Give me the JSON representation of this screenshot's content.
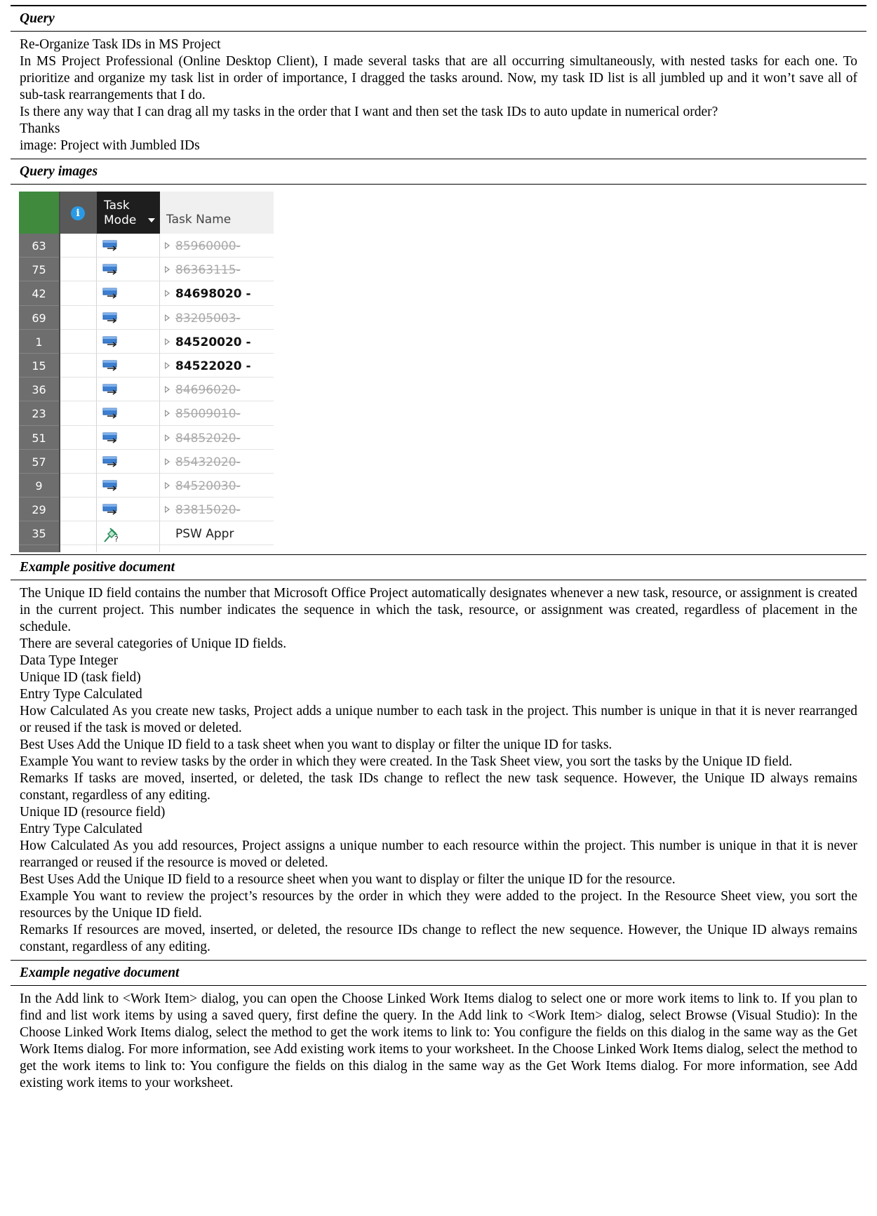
{
  "query": {
    "heading": "Query",
    "title": "Re-Organize Task IDs in MS Project",
    "paragraph1": "In MS Project Professional (Online Desktop Client), I made several tasks that are all occurring simultaneously, with nested tasks for each one. To prioritize and organize my task list in order of importance, I dragged the tasks around. Now, my task ID list is all jumbled up and it won’t save all of sub-task rearrangements that I do.",
    "paragraph2": "Is there any way that I can drag all my tasks in the order that I want and then set the task IDs to auto update in numerical order?",
    "paragraph3": "Thanks",
    "paragraph4": "image: Project with Jumbled IDs"
  },
  "query_images": {
    "heading": "Query images",
    "grid": {
      "col_info_icon": "info-icon",
      "col_info_glyph": "i",
      "col_mode_line1": "Task",
      "col_mode_line2": "Mode",
      "col_name": "Task Name",
      "colors": {
        "id_header": "#3f8a3d",
        "id_cell": "#6e6e6e",
        "mode_header": "#1e1e1e",
        "info_icon": "#2b9ae6"
      },
      "rows": [
        {
          "id": "63",
          "name": "85960000-",
          "style": "inactive",
          "mode": "auto"
        },
        {
          "id": "75",
          "name": "86363115-",
          "style": "inactive",
          "mode": "auto"
        },
        {
          "id": "42",
          "name": "84698020 -",
          "style": "bold",
          "mode": "auto"
        },
        {
          "id": "69",
          "name": "83205003-",
          "style": "inactive",
          "mode": "auto"
        },
        {
          "id": "1",
          "name": "84520020 -",
          "style": "bold",
          "mode": "auto"
        },
        {
          "id": "15",
          "name": "84522020 -",
          "style": "bold",
          "mode": "auto"
        },
        {
          "id": "36",
          "name": "84696020-",
          "style": "inactive",
          "mode": "auto"
        },
        {
          "id": "23",
          "name": "85009010-",
          "style": "inactive",
          "mode": "auto"
        },
        {
          "id": "51",
          "name": "84852020-",
          "style": "inactive",
          "mode": "auto"
        },
        {
          "id": "57",
          "name": "85432020-",
          "style": "inactive",
          "mode": "auto"
        },
        {
          "id": "9",
          "name": "84520030-",
          "style": "inactive",
          "mode": "auto"
        },
        {
          "id": "29",
          "name": "83815020-",
          "style": "inactive",
          "mode": "auto"
        },
        {
          "id": "35",
          "name": "PSW Appr",
          "style": "plain",
          "mode": "manual"
        }
      ]
    }
  },
  "positive": {
    "heading": "Example positive document",
    "lines": [
      "The Unique ID field contains the number that Microsoft Office Project automatically designates whenever a new task, resource, or assignment is created in the current project. This number indicates the sequence in which the task, resource, or assignment was created, regardless of placement in the schedule.",
      "There are several categories of Unique ID fields.",
      "Data Type Integer",
      "Unique ID (task field)",
      "Entry Type Calculated",
      "How Calculated As you create new tasks, Project adds a unique number to each task in the project. This number is unique in that it is never rearranged or reused if the task is moved or deleted.",
      "Best Uses Add the Unique ID field to a task sheet when you want to display or filter the unique ID for tasks.",
      "Example You want to review tasks by the order in which they were created. In the Task Sheet view, you sort the tasks by the Unique ID field.",
      "Remarks If tasks are moved, inserted, or deleted, the task IDs change to reflect the new task sequence. However, the Unique ID always remains constant, regardless of any editing.",
      "Unique ID (resource field)",
      "Entry Type Calculated",
      "How Calculated As you add resources, Project assigns a unique number to each resource within the project. This number is unique in that it is never rearranged or reused if the resource is moved or deleted.",
      "Best Uses Add the Unique ID field to a resource sheet when you want to display or filter the unique ID for the resource.",
      "Example You want to review the project’s resources by the order in which they were added to the project. In the Resource Sheet view, you sort the resources by the Unique ID field.",
      "Remarks If resources are moved, inserted, or deleted, the resource IDs change to reflect the new sequence. However, the Unique ID always remains constant, regardless of any editing."
    ]
  },
  "negative": {
    "heading": "Example negative document",
    "text": "In the Add link to <Work Item> dialog, you can open the Choose Linked Work Items dialog to select one or more work items to link to. If you plan to find and list work items by using a saved query, first define the query. In the Add link to <Work Item> dialog, select Browse (Visual Studio): In the Choose Linked Work Items dialog, select the method to get the work items to link to: You configure the fields on this dialog in the same way as the Get Work Items dialog. For more information, see Add existing work items to your worksheet. In the Choose Linked Work Items dialog, select the method to get the work items to link to: You configure the fields on this dialog in the same way as the Get Work Items dialog. For more information, see Add existing work items to your worksheet."
  }
}
